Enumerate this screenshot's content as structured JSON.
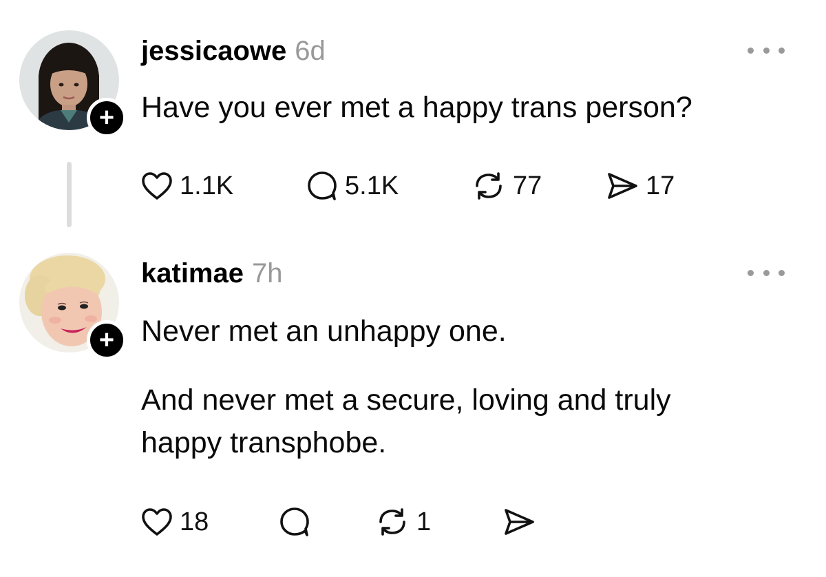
{
  "posts": [
    {
      "username": "jessicaowe",
      "time": "6d",
      "text_lines": [
        "Have you ever met a happy trans person?"
      ],
      "follow_icon": "plus-icon",
      "follow_symbol": "+",
      "actions": {
        "likes": "1.1K",
        "replies": "5.1K",
        "reposts": "77",
        "shares": "17"
      }
    },
    {
      "username": "katimae",
      "time": "7h",
      "text_lines": [
        "Never met an unhappy one.",
        "And never met a secure, loving and truly",
        "happy transphobe."
      ],
      "follow_icon": "plus-icon",
      "follow_symbol": "+",
      "actions": {
        "likes": "18",
        "replies": "",
        "reposts": "1",
        "shares": ""
      }
    }
  ],
  "icons": {
    "like": "heart-icon",
    "reply": "speech-bubble-icon",
    "repost": "repost-arrows-icon",
    "share": "paper-plane-icon",
    "more": "more-dots-icon"
  },
  "colors": {
    "background": "#ffffff",
    "text": "#000000",
    "muted": "#999999",
    "badge": "#000000",
    "thread_line": "#dcdcdc"
  }
}
